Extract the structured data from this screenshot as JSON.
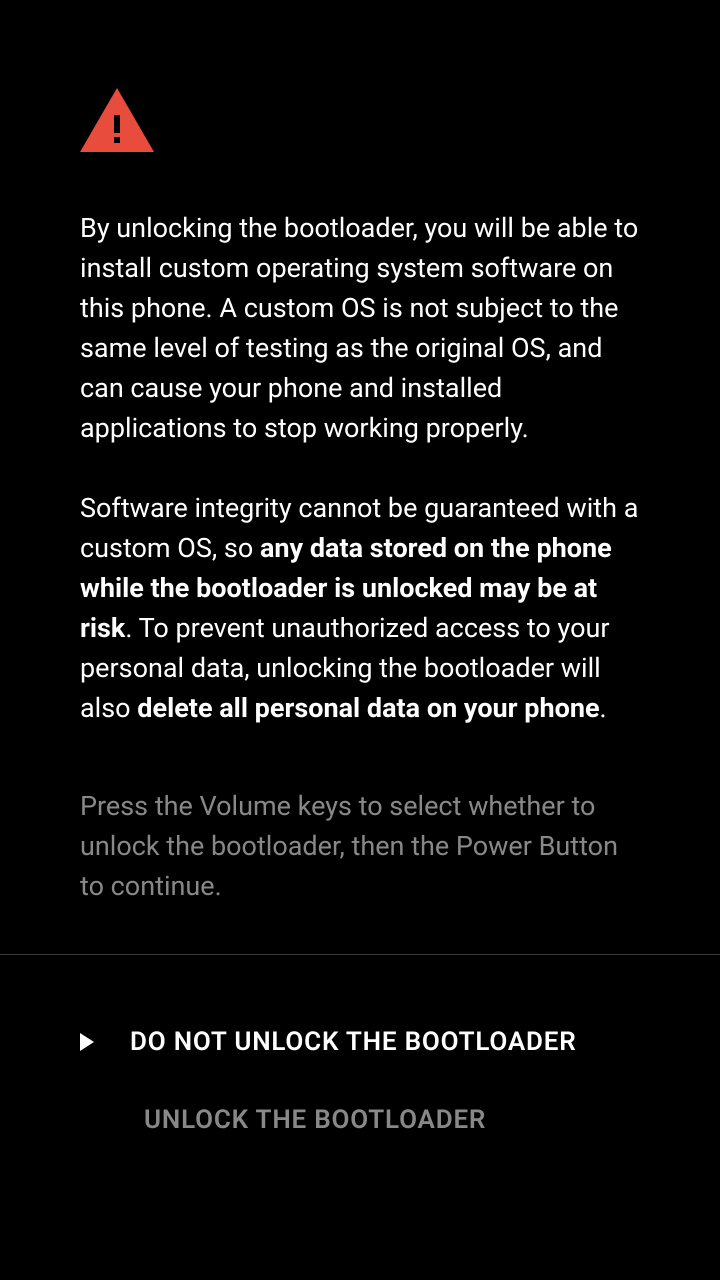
{
  "warning_icon_color": "#e74c3c",
  "paragraph1": "By unlocking the bootloader, you will be able to install custom operating system software on this phone. A custom OS is not subject to the same level of testing as the original OS, and can cause your phone and installed applications to stop working properly.",
  "paragraph2_prefix": "Software integrity cannot be guaranteed with a custom OS, so ",
  "paragraph2_bold1": "any data stored on the phone while the bootloader is unlocked may be at risk",
  "paragraph2_middle": ". To prevent unauthorized access to your personal data, unlocking the bootloader will also ",
  "paragraph2_bold2": "delete all personal data on your phone",
  "paragraph2_suffix": ".",
  "instructions": "Press the Volume keys to select whether to unlock the bootloader, then the Power Button to continue.",
  "options": {
    "do_not_unlock": "DO NOT UNLOCK THE BOOTLOADER",
    "unlock": "UNLOCK THE BOOTLOADER"
  }
}
